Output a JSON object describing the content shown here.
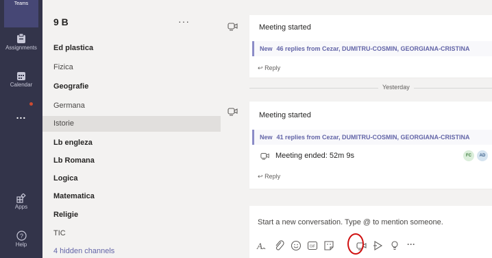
{
  "appbar": {
    "brand": "Teams",
    "items": [
      {
        "label": "Assignments",
        "icon": "assignments-icon"
      },
      {
        "label": "Calendar",
        "icon": "calendar-icon"
      },
      {
        "label": "...",
        "icon": "more-icon"
      },
      {
        "label": "Apps",
        "icon": "apps-icon"
      },
      {
        "label": "Help",
        "icon": "help-icon"
      }
    ]
  },
  "team": {
    "name": "9 B",
    "more": "···",
    "channels": [
      {
        "label": "Ed plastica",
        "bold": true
      },
      {
        "label": "Fizica",
        "bold": false
      },
      {
        "label": "Geografie",
        "bold": true
      },
      {
        "label": "Germana",
        "bold": false
      },
      {
        "label": "Istorie",
        "bold": false,
        "active": true
      },
      {
        "label": "Lb engleza",
        "bold": true
      },
      {
        "label": "Lb Romana",
        "bold": true
      },
      {
        "label": "Logica",
        "bold": true
      },
      {
        "label": "Matematica",
        "bold": true
      },
      {
        "label": "Religie",
        "bold": true
      },
      {
        "label": "TIC",
        "bold": false
      }
    ],
    "hidden": "4 hidden channels"
  },
  "feed": {
    "post1": {
      "title": "Meeting started",
      "new_tag": "New",
      "replies": "46 replies from Cezar, DUMITRU-COSMIN, GEORGIANA-CRISTINA",
      "reply": "Reply"
    },
    "day_divider": "Yesterday",
    "post2": {
      "title": "Meeting started",
      "new_tag": "New",
      "replies": "41 replies from Cezar, DUMITRU-COSMIN, GEORGIANA-CRISTINA",
      "ended": "Meeting ended: 52m 9s",
      "avatars": [
        "FC",
        "AD"
      ],
      "reply": "Reply"
    }
  },
  "compose": {
    "placeholder": "Start a new conversation. Type @ to mention someone.",
    "tools": [
      "format-icon",
      "attach-icon",
      "emoji-icon",
      "gif-icon",
      "sticker-icon",
      "meet-now-icon",
      "stream-icon",
      "praise-icon",
      "more-options-icon"
    ],
    "gif": "GIF",
    "more": "···"
  },
  "colors": {
    "appbar": "#33344a",
    "accent": "#6264a7",
    "highlight": "#d01010"
  }
}
